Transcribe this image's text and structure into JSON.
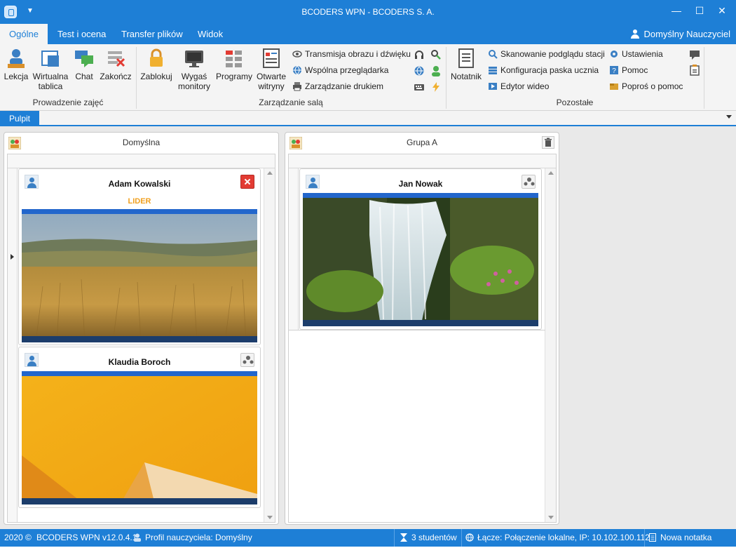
{
  "window": {
    "title": "BCODERS WPN - BCODERS S. A.",
    "minimize_symbol": "—",
    "maximize_symbol": "☐",
    "close_symbol": "✕"
  },
  "tabs": [
    {
      "label": "Ogólne",
      "active": true
    },
    {
      "label": "Test i ocena",
      "active": false
    },
    {
      "label": "Transfer plików",
      "active": false
    },
    {
      "label": "Widok",
      "active": false
    }
  ],
  "user": {
    "label": "Domyślny Nauczyciel"
  },
  "ribbon": {
    "groups": {
      "lesson": "Prowadzenie zajęć",
      "room": "Zarządzanie salą",
      "other": "Pozostałe"
    },
    "lesson_buttons": [
      {
        "label": "Lekcja",
        "icon": "teacher-icon"
      },
      {
        "label": "Wirtualna tablica",
        "icon": "whiteboard-icon"
      },
      {
        "label": "Chat",
        "icon": "chat-icon"
      },
      {
        "label": "Zakończ",
        "icon": "end-lesson-icon"
      }
    ],
    "room_buttons": [
      {
        "label": "Zablokuj",
        "icon": "lock-icon"
      },
      {
        "label": "Wygaś monitory",
        "icon": "monitor-icon"
      },
      {
        "label": "Programy",
        "icon": "programs-icon"
      },
      {
        "label": "Otwarte witryny",
        "icon": "websites-icon"
      }
    ],
    "room_small": [
      {
        "label": "Transmisja obrazu i dźwięku",
        "icon": "eye-icon"
      },
      {
        "label": "Wspólna przeglądarka",
        "icon": "globe-icon"
      },
      {
        "label": "Zarządzanie drukiem",
        "icon": "printer-icon"
      }
    ],
    "room_icons": [
      "headphones-icon",
      "remote-icon",
      "web-filter-icon",
      "user-green-icon",
      "keyboard-icon",
      "power-icon"
    ],
    "other_big": {
      "label": "Notatnik",
      "icon": "notepad-icon"
    },
    "other_small": [
      {
        "label": "Skanowanie podglądu stacji",
        "icon": "scan-icon"
      },
      {
        "label": "Konfiguracja paska ucznia",
        "icon": "student-bar-icon"
      },
      {
        "label": "Edytor wideo",
        "icon": "video-editor-icon"
      }
    ],
    "settings_small": [
      {
        "label": "Ustawienia",
        "icon": "gear-icon"
      },
      {
        "label": "Pomoc",
        "icon": "help-icon"
      },
      {
        "label": "Poproś o pomoc",
        "icon": "help-request-icon"
      }
    ],
    "extra_icons": [
      "message-icon",
      "clipboard-icon"
    ]
  },
  "subbar": {
    "tab": "Pulpit"
  },
  "groups": [
    {
      "title": "Domyślna",
      "students": [
        {
          "name": "Adam Kowalski",
          "badge": "LIDER",
          "action": "remove"
        },
        {
          "name": "Klaudia Boroch",
          "badge": "",
          "action": "group"
        }
      ]
    },
    {
      "title": "Grupa A",
      "students": [
        {
          "name": "Jan Nowak",
          "badge": "",
          "action": "group"
        }
      ]
    }
  ],
  "statusbar": {
    "copyright": "2020 ©",
    "version": "BCODERS WPN v12.0.4.1",
    "profile": "Profil nauczyciela: Domyślny",
    "students": "3 studentów",
    "connection": "Łącze: Połączenie lokalne, IP: 10.102.100.112",
    "note": "Nowa notatka"
  },
  "colors": {
    "accent": "#1e7fd6",
    "lider": "#f0a020",
    "remove": "#e23b33"
  }
}
